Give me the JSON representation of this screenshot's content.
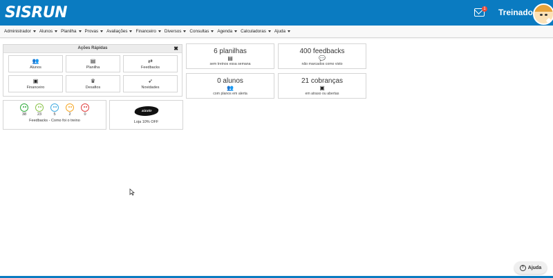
{
  "header": {
    "logo": "SISRUN",
    "notification_count": "1",
    "username": "Treinador",
    "brand_color": "#0a7bc1"
  },
  "menu": [
    {
      "label": "Administrador"
    },
    {
      "label": "Alunos"
    },
    {
      "label": "Planilha"
    },
    {
      "label": "Provas"
    },
    {
      "label": "Avaliações"
    },
    {
      "label": "Financeiro"
    },
    {
      "label": "Diversos"
    },
    {
      "label": "Consultas"
    },
    {
      "label": "Agenda"
    },
    {
      "label": "Calculadoras"
    },
    {
      "label": "Ajuda"
    }
  ],
  "quick_actions": {
    "title": "Ações Rápidas",
    "close": "✖",
    "items": [
      {
        "label": "Alunos",
        "icon": "users-icon"
      },
      {
        "label": "Planilha",
        "icon": "id-card-icon"
      },
      {
        "label": "Feedbacks",
        "icon": "retweet-icon"
      },
      {
        "label": "Financeiro",
        "icon": "money-icon"
      },
      {
        "label": "Desafios",
        "icon": "trophy-icon"
      },
      {
        "label": "Novidades",
        "icon": "rocket-icon"
      }
    ]
  },
  "stats": [
    {
      "value": "6 planilhas",
      "sub": "sem treinos essa semana",
      "icon": "id-card-icon"
    },
    {
      "value": "400 feedbacks",
      "sub": "não marcados como visto",
      "icon": "comments-icon"
    },
    {
      "value": "0 alunos",
      "sub": "com planos em alerta",
      "icon": "users-icon"
    },
    {
      "value": "21 cobranças",
      "sub": "em atraso ou abertas",
      "icon": "money-icon"
    }
  ],
  "feedbacks": {
    "faces": [
      {
        "count": "38",
        "color": "#2eaa3a"
      },
      {
        "count": "23",
        "color": "#8bc34a"
      },
      {
        "count": "5",
        "color": "#3fa9e0"
      },
      {
        "count": "2",
        "color": "#f5a623"
      },
      {
        "count": "0",
        "color": "#e04040"
      }
    ],
    "label": "Feedbacks - Como foi o treino"
  },
  "shop": {
    "logo_text": "sixxto",
    "label": "Loja 10% OFF"
  },
  "help": {
    "label": "Ajuda"
  }
}
